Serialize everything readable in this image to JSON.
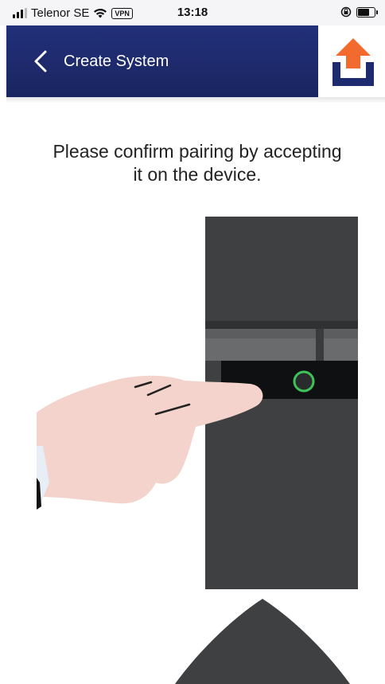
{
  "status_bar": {
    "carrier": "Telenor SE",
    "vpn_label": "VPN",
    "time": "13:18",
    "battery_level": 0.8,
    "icons": [
      "signal-icon",
      "wifi-icon",
      "vpn-icon",
      "rotation-lock-icon",
      "battery-icon"
    ]
  },
  "header": {
    "title": "Create System",
    "back_icon": "chevron-left-icon",
    "logo_icon": "upload-arrow-logo",
    "colors": {
      "bar": "#1d2a6d",
      "logo_arrow": "#f26a2e",
      "logo_tray": "#1d2a6d"
    }
  },
  "main": {
    "instruction": "Please confirm pairing by accepting it on the device.",
    "illustration": "hand-pressing-device-button",
    "colors": {
      "device": "#3e4042",
      "button_ring": "#3ec35a",
      "hand": "#f3d3cb"
    }
  }
}
